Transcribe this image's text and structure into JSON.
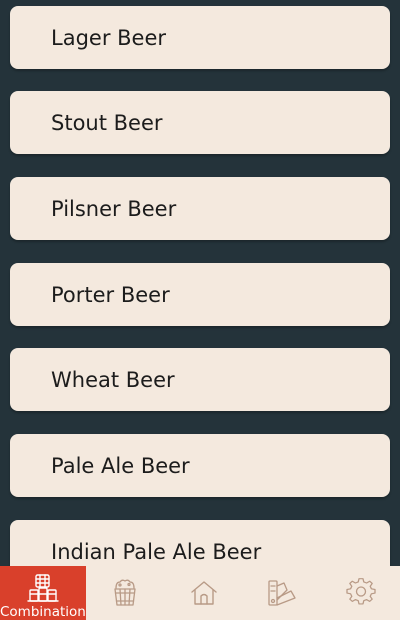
{
  "beers": [
    {
      "label": "Lager Beer"
    },
    {
      "label": "Stout Beer"
    },
    {
      "label": "Pilsner Beer"
    },
    {
      "label": "Porter Beer"
    },
    {
      "label": "Wheat Beer"
    },
    {
      "label": "Pale Ale Beer"
    },
    {
      "label": "Indian Pale Ale Beer"
    }
  ],
  "tabs": [
    {
      "label": "Combination",
      "icon": "combination-icon",
      "active": true
    },
    {
      "label": "",
      "icon": "beer-barrel-icon",
      "active": false
    },
    {
      "label": "",
      "icon": "home-icon",
      "active": false
    },
    {
      "label": "",
      "icon": "color-swatch-icon",
      "active": false
    },
    {
      "label": "",
      "icon": "settings-gear-icon",
      "active": false
    }
  ],
  "colors": {
    "background": "#24333a",
    "card": "#f4e9de",
    "active_tab": "#d9402b",
    "icon": "#b89a86"
  }
}
